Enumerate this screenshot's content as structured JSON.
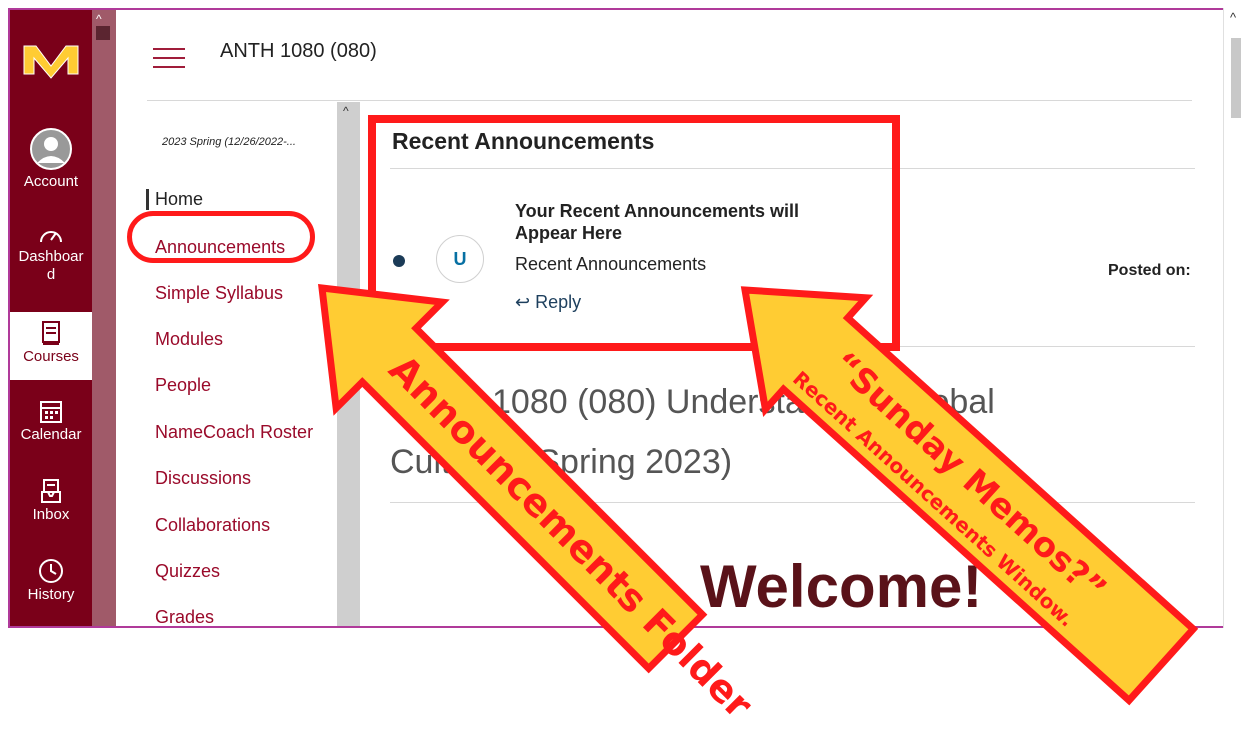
{
  "rail": {
    "items": [
      {
        "label": "Account"
      },
      {
        "label": "Dashboar\nd"
      },
      {
        "label": "Courses"
      },
      {
        "label": "Calendar"
      },
      {
        "label": "Inbox"
      },
      {
        "label": "History"
      }
    ]
  },
  "header": {
    "course": "ANTH 1080 (080)"
  },
  "course_nav": {
    "term": "2023 Spring (12/26/2022-...",
    "items": [
      "Home",
      "Announcements",
      "Simple Syllabus",
      "Modules",
      "People",
      "NameCoach Roster",
      "Discussions",
      "Collaborations",
      "Quizzes",
      "Grades"
    ]
  },
  "recent": {
    "title": "Recent Announcements",
    "item_title": "Your Recent Announcements will Appear Here",
    "item_sub": "Recent Announcements",
    "avatar": "U",
    "reply": "Reply",
    "posted": "Posted on:"
  },
  "content": {
    "course_title_visible": "ANTH 1080 (080) Understanding Global Cultures (Spring 2023)",
    "welcome": "Welcome!"
  },
  "annotations": {
    "arrow1": "Announcements Folder",
    "arrow2_line1": "“Sunday Memos?”",
    "arrow2_line2": "Recent Announcements Window."
  },
  "colors": {
    "maroon": "#7a0019",
    "gold": "#ffcc33",
    "highlight": "#ff1a1a",
    "link": "#9a0a2a"
  }
}
